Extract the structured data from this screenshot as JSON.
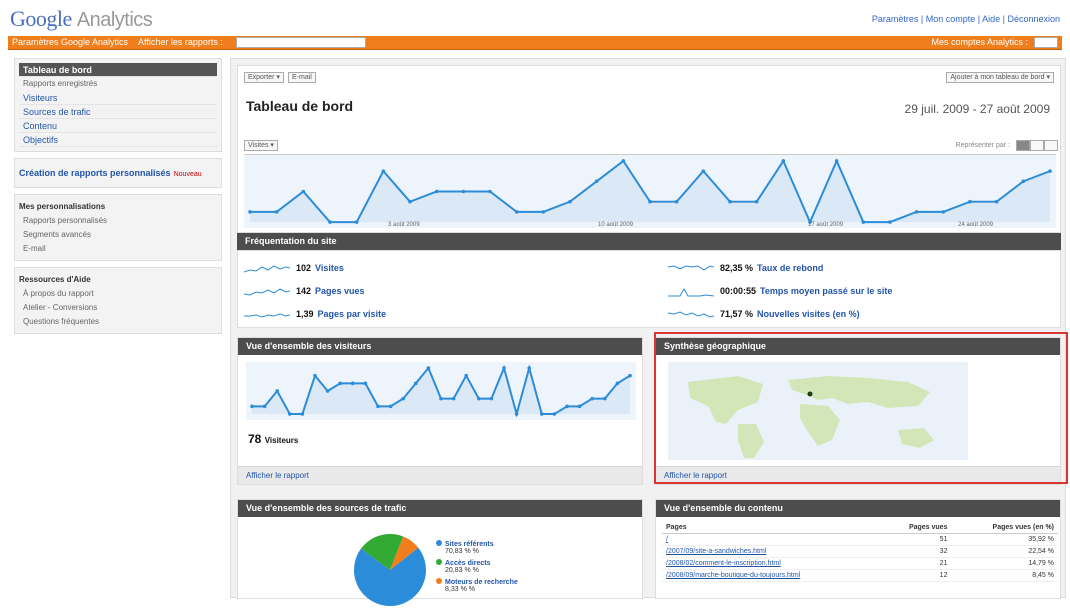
{
  "app": {
    "logo_google": "Google",
    "logo_analytics": "Analytics",
    "top_links": "Paramètres | Mon compte | Aide | Déconnexion"
  },
  "orange_bar": {
    "link1": "Paramètres Google Analytics",
    "link2": "Afficher les rapports :",
    "right_label": "Mes comptes Analytics :"
  },
  "sidebar": {
    "nav": [
      {
        "label": "Tableau de bord",
        "active": true
      },
      {
        "label": "Rapports enregistrés",
        "small": true
      },
      {
        "label": "Visiteurs"
      },
      {
        "label": "Sources de trafic"
      },
      {
        "label": "Contenu"
      },
      {
        "label": "Objectifs"
      }
    ],
    "custom_reports": "Création de rapports personnalisés",
    "new_badge": "Nouveau",
    "perso_title": "Mes personnalisations",
    "perso_items": [
      "Rapports personnalisés",
      "Segments avancés",
      "E-mail"
    ],
    "help_title": "Ressources d'Aide",
    "help_items": [
      "À propos du rapport",
      "Atelier - Conversions",
      "Questions fréquentes"
    ]
  },
  "header": {
    "export_btn": "Exporter ▾",
    "email_btn": "E-mail",
    "add_btn": "Ajouter à mon tableau de bord ▾",
    "title": "Tableau de bord",
    "date_range": "29 juil. 2009 - 27 août 2009",
    "metric_select": "Visites ▾",
    "graph_label": "Représenter par :",
    "x_ticks": [
      "3 août 2009",
      "10 août 2009",
      "17 août 2009",
      "24 août 2009"
    ]
  },
  "chart_data": [
    {
      "type": "area",
      "title": "Visites",
      "series": [
        {
          "name": "Visites",
          "values": [
            1,
            1,
            3,
            0,
            0,
            5,
            2,
            3,
            3,
            3,
            1,
            1,
            2,
            4,
            6,
            2,
            2,
            5,
            2,
            2,
            6,
            0,
            6,
            0,
            0,
            1,
            1,
            2,
            2,
            4,
            5
          ]
        }
      ],
      "ylim": [
        0,
        6
      ]
    },
    {
      "type": "area",
      "title": "Visiteurs",
      "series": [
        {
          "name": "Visiteurs",
          "values": [
            1,
            1,
            3,
            0,
            0,
            5,
            3,
            4,
            4,
            4,
            1,
            1,
            2,
            4,
            6,
            2,
            2,
            5,
            2,
            2,
            6,
            0,
            6,
            0,
            0,
            1,
            1,
            2,
            2,
            4,
            5
          ]
        }
      ],
      "ylim": [
        0,
        6
      ]
    },
    {
      "type": "pie",
      "series": [
        {
          "name": "Sources",
          "values": [
            70.83,
            20.83,
            8.33
          ]
        }
      ],
      "labels": [
        "Sites référents",
        "Accès directs",
        "Moteurs de recherche"
      ]
    }
  ],
  "frequentation": {
    "title": "Fréquentation du site",
    "stats": [
      {
        "value": "102",
        "label": "Visites"
      },
      {
        "value": "142",
        "label": "Pages vues"
      },
      {
        "value": "1,39",
        "label": "Pages par visite"
      },
      {
        "value": "82,35 %",
        "label": "Taux de rebond"
      },
      {
        "value": "00:00:55",
        "label": "Temps moyen passé sur le site"
      },
      {
        "value": "71,57 %",
        "label": "Nouvelles visites (en %)"
      }
    ]
  },
  "visitors_card": {
    "title": "Vue d'ensemble des visiteurs",
    "count": "78",
    "count_label": "Visiteurs",
    "footer": "Afficher le rapport"
  },
  "geo_card": {
    "title": "Synthèse géographique",
    "footer": "Afficher le rapport"
  },
  "traffic_card": {
    "title": "Vue d'ensemble des sources de trafic",
    "legend": [
      {
        "name": "Sites référents",
        "value": "70,83 % %",
        "color": "#2b8cd9"
      },
      {
        "name": "Accès directs",
        "value": "20,83 % %",
        "color": "#33aa33"
      },
      {
        "name": "Moteurs de recherche",
        "value": "8,33 % %",
        "color": "#f07e1c"
      }
    ]
  },
  "content_card": {
    "title": "Vue d'ensemble du contenu",
    "headers": [
      "Pages",
      "Pages vues",
      "Pages vues (en %)"
    ],
    "rows": [
      [
        "/",
        "51",
        "35,92 %"
      ],
      [
        "/2007/09/site-a-sandwiches.html",
        "32",
        "22,54 %"
      ],
      [
        "/2008/02/comment-le-inscription.html",
        "21",
        "14,79 %"
      ],
      [
        "/2008/09/marche-boutique-du-toujours.html",
        "12",
        "8,45 %"
      ]
    ]
  }
}
